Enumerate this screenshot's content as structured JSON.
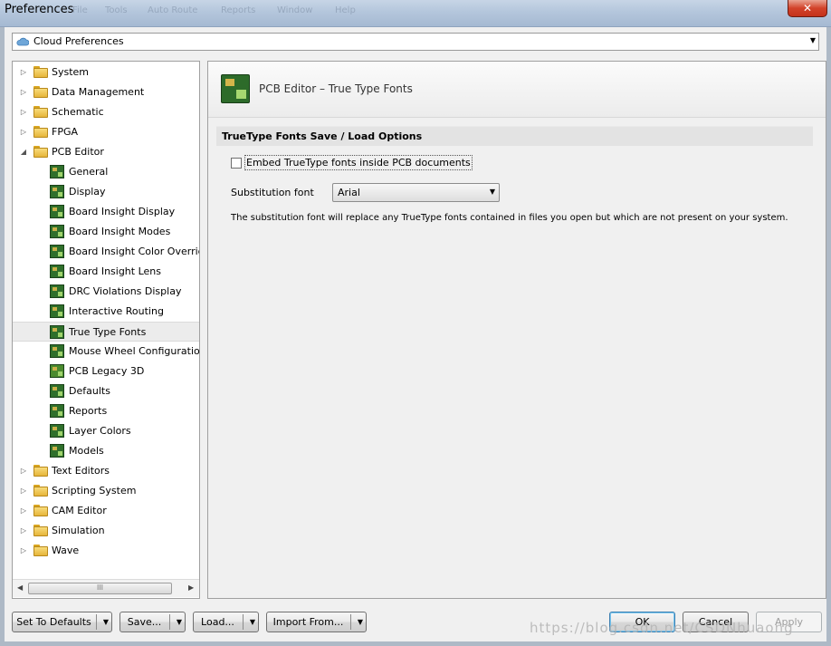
{
  "window": {
    "title": "Preferences",
    "close_label": "✕"
  },
  "background_menu": [
    "File",
    "Tools",
    "Auto Route",
    "Reports",
    "Window",
    "Help"
  ],
  "cloud": {
    "label": "Cloud Preferences",
    "icon": "cloud-icon"
  },
  "tree": {
    "items": [
      {
        "label": "System",
        "kind": "folder",
        "level": 0,
        "expander": "▷"
      },
      {
        "label": "Data Management",
        "kind": "folder",
        "level": 0,
        "expander": "▷"
      },
      {
        "label": "Schematic",
        "kind": "folder",
        "level": 0,
        "expander": "▷"
      },
      {
        "label": "FPGA",
        "kind": "folder",
        "level": 0,
        "expander": "▷"
      },
      {
        "label": "PCB Editor",
        "kind": "folder",
        "level": 0,
        "expander": "◢"
      },
      {
        "label": "General",
        "kind": "pcb",
        "level": 1
      },
      {
        "label": "Display",
        "kind": "pcb",
        "level": 1
      },
      {
        "label": "Board Insight Display",
        "kind": "pcb",
        "level": 1
      },
      {
        "label": "Board Insight Modes",
        "kind": "pcb",
        "level": 1
      },
      {
        "label": "Board Insight Color Overrides",
        "kind": "pcb",
        "level": 1
      },
      {
        "label": "Board Insight Lens",
        "kind": "pcb",
        "level": 1
      },
      {
        "label": "DRC Violations Display",
        "kind": "pcb",
        "level": 1
      },
      {
        "label": "Interactive Routing",
        "kind": "pcb",
        "level": 1
      },
      {
        "label": "True Type Fonts",
        "kind": "pcb",
        "level": 1,
        "selected": true
      },
      {
        "label": "Mouse Wheel Configuration",
        "kind": "pcb",
        "level": 1
      },
      {
        "label": "PCB Legacy 3D",
        "kind": "pcb3d",
        "level": 1
      },
      {
        "label": "Defaults",
        "kind": "pcb",
        "level": 1
      },
      {
        "label": "Reports",
        "kind": "pcb",
        "level": 1
      },
      {
        "label": "Layer Colors",
        "kind": "pcb",
        "level": 1
      },
      {
        "label": "Models",
        "kind": "pcb",
        "level": 1
      },
      {
        "label": "Text Editors",
        "kind": "folder",
        "level": 0,
        "expander": "▷"
      },
      {
        "label": "Scripting System",
        "kind": "folder",
        "level": 0,
        "expander": "▷"
      },
      {
        "label": "CAM Editor",
        "kind": "folder",
        "level": 0,
        "expander": "▷"
      },
      {
        "label": "Simulation",
        "kind": "folder",
        "level": 0,
        "expander": "▷"
      },
      {
        "label": "Wave",
        "kind": "folder",
        "level": 0,
        "expander": "▷"
      }
    ],
    "scroll_grip": "III"
  },
  "page": {
    "title": "PCB Editor – True Type Fonts",
    "section_title": "TrueType Fonts Save / Load Options",
    "embed_checkbox": {
      "label": "Embed TrueType fonts inside PCB documents",
      "checked": false
    },
    "substitution": {
      "label": "Substitution font",
      "value": "Arial"
    },
    "description": "The substitution font will replace any TrueType fonts contained in files you open but which are not present on your system."
  },
  "buttons": {
    "set_defaults": "Set To Defaults",
    "save": "Save...",
    "load": "Load...",
    "import_from": "Import From...",
    "ok": "OK",
    "cancel": "Cancel",
    "apply": "Apply"
  },
  "watermark": "https://blog.csdn.net/CSDNhuaong"
}
